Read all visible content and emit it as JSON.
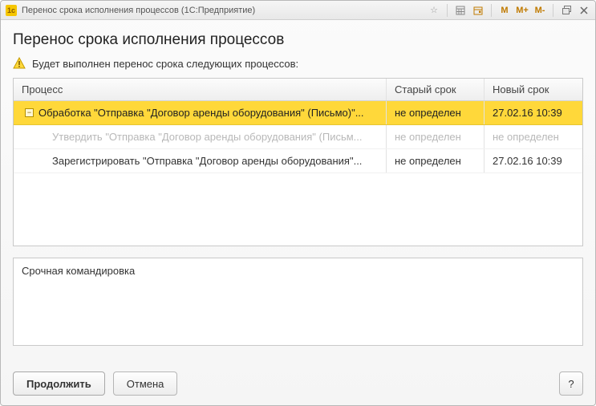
{
  "titlebar": {
    "logo_text": "1c",
    "title": "Перенос срока исполнения процессов  (1С:Предприятие)",
    "mem_m": "M",
    "mem_mplus": "M+",
    "mem_mminus": "M-"
  },
  "page": {
    "title": "Перенос срока исполнения процессов",
    "info_text": "Будет выполнен перенос срока следующих процессов:"
  },
  "table": {
    "headers": {
      "process": "Процесс",
      "old_deadline": "Старый срок",
      "new_deadline": "Новый срок"
    },
    "rows": [
      {
        "process": "Обработка \"Отправка \"Договор аренды оборудования\" (Письмо)\"...",
        "old_deadline": "не определен",
        "new_deadline": "27.02.16 10:39",
        "indent": 0,
        "selected": true,
        "disabled": false,
        "expandable": true
      },
      {
        "process": "Утвердить \"Отправка \"Договор аренды оборудования\" (Письм...",
        "old_deadline": "не определен",
        "new_deadline": "не определен",
        "indent": 1,
        "selected": false,
        "disabled": true,
        "expandable": false
      },
      {
        "process": "Зарегистрировать \"Отправка \"Договор аренды оборудования\"...",
        "old_deadline": "не определен",
        "new_deadline": "27.02.16 10:39",
        "indent": 1,
        "selected": false,
        "disabled": false,
        "expandable": false
      }
    ]
  },
  "comment": {
    "value": "Срочная командировка"
  },
  "footer": {
    "continue_label": "Продолжить",
    "cancel_label": "Отмена",
    "help_label": "?"
  }
}
